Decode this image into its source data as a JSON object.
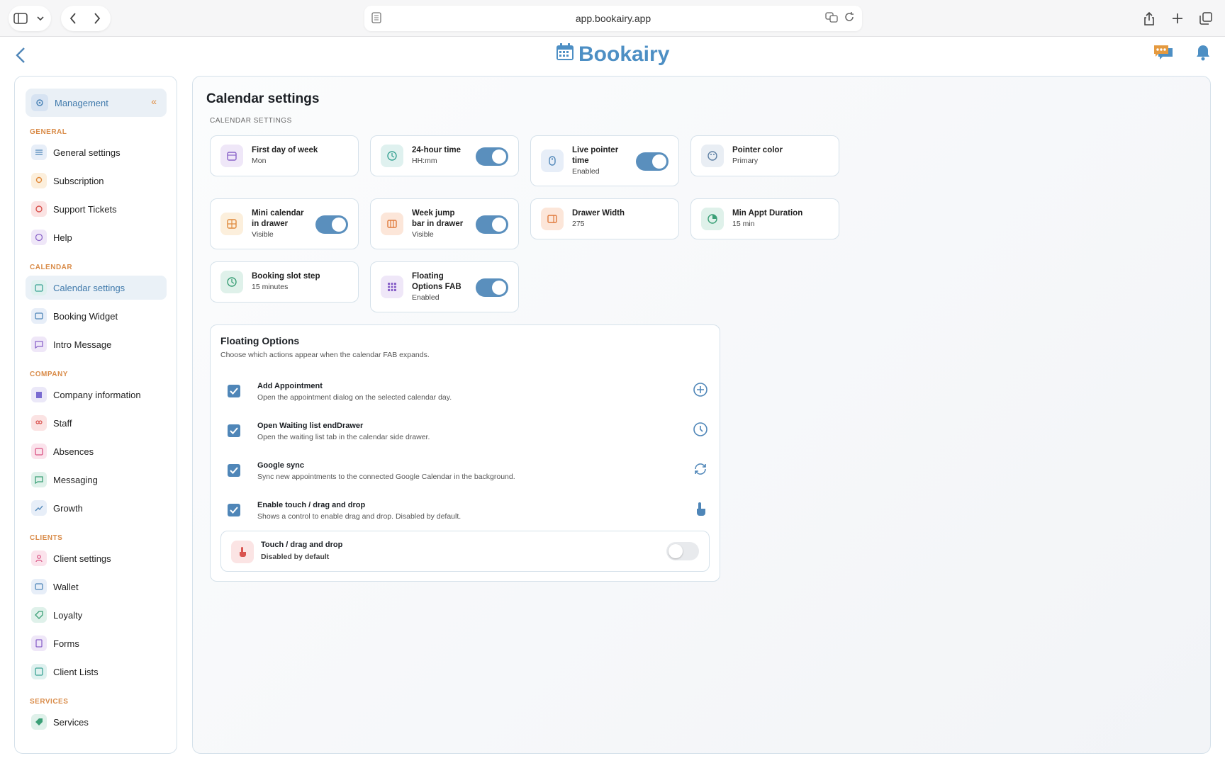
{
  "browser": {
    "url": "app.bookairy.app"
  },
  "app": {
    "name": "Bookairy"
  },
  "sidebar": {
    "header": "Management",
    "sections": {
      "general": "GENERAL",
      "calendar": "CALENDAR",
      "company": "COMPANY",
      "clients": "CLIENTS",
      "services": "SERVICES"
    },
    "items": {
      "general_settings": "General settings",
      "subscription": "Subscription",
      "support_tickets": "Support Tickets",
      "help": "Help",
      "calendar_settings": "Calendar settings",
      "booking_widget": "Booking Widget",
      "intro_message": "Intro Message",
      "company_information": "Company information",
      "staff": "Staff",
      "absences": "Absences",
      "messaging": "Messaging",
      "growth": "Growth",
      "client_settings": "Client settings",
      "wallet": "Wallet",
      "loyalty": "Loyalty",
      "forms": "Forms",
      "client_lists": "Client Lists",
      "services": "Services"
    }
  },
  "main": {
    "title": "Calendar settings",
    "section_label": "CALENDAR SETTINGS",
    "cards": [
      {
        "title": "First day of week",
        "value": "Mon"
      },
      {
        "title": "24-hour time",
        "value": "HH:mm",
        "toggle": true
      },
      {
        "title": "Live pointer time",
        "value": "Enabled",
        "toggle": true
      },
      {
        "title": "Pointer color",
        "value": "Primary"
      },
      {
        "title": "Mini calendar in drawer",
        "value": "Visible",
        "toggle": true
      },
      {
        "title": "Week jump bar in drawer",
        "value": "Visible",
        "toggle": true
      },
      {
        "title": "Drawer Width",
        "value": "275"
      },
      {
        "title": "Min Appt Duration",
        "value": "15 min"
      },
      {
        "title": "Booking slot step",
        "value": "15 minutes"
      },
      {
        "title": "Floating Options FAB",
        "value": "Enabled",
        "toggle": true
      }
    ],
    "floating": {
      "title": "Floating Options",
      "description": "Choose which actions appear when the calendar FAB expands.",
      "options": [
        {
          "title": "Add Appointment",
          "desc": "Open the appointment dialog on the selected calendar day.",
          "checked": true,
          "icon": "plus-circle-icon"
        },
        {
          "title": "Open Waiting list endDrawer",
          "desc": "Open the waiting list tab in the calendar side drawer.",
          "checked": true,
          "icon": "clock-icon"
        },
        {
          "title": "Google sync",
          "desc": "Sync new appointments to the connected Google Calendar in the background.",
          "checked": true,
          "icon": "sync-icon"
        },
        {
          "title": "Enable touch / drag and drop",
          "desc": "Shows a control to enable drag and drop. Disabled by default.",
          "checked": true,
          "icon": "touch-icon"
        }
      ],
      "touch_card": {
        "title": "Touch / drag and drop",
        "value": "Disabled by default",
        "toggle": false
      }
    }
  }
}
